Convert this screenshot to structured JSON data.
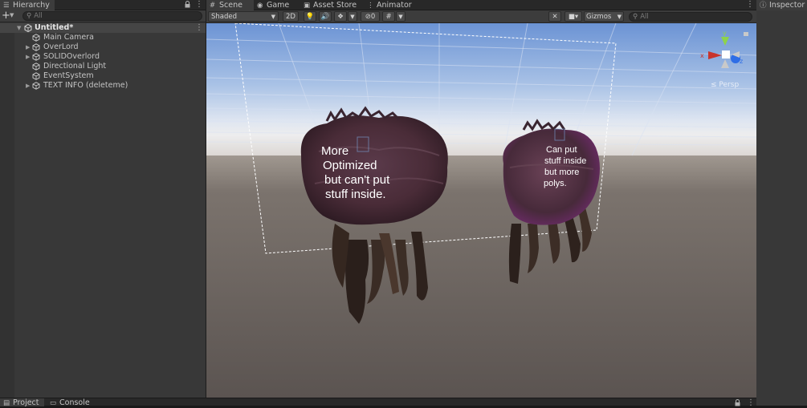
{
  "hierarchy": {
    "tab_label": "Hierarchy",
    "add_label": "+",
    "search_placeholder": "All",
    "root": "Untitled*",
    "items": [
      {
        "label": "Main Camera",
        "expandable": false
      },
      {
        "label": "OverLord",
        "expandable": true
      },
      {
        "label": "SOLIDOverlord",
        "expandable": true
      },
      {
        "label": "Directional Light",
        "expandable": false
      },
      {
        "label": "EventSystem",
        "expandable": false
      },
      {
        "label": "TEXT INFO (deleteme)",
        "expandable": true
      }
    ]
  },
  "scene": {
    "tabs": [
      {
        "label": "Scene",
        "icon": "hash-icon"
      },
      {
        "label": "Game",
        "icon": "gamepad-icon"
      },
      {
        "label": "Asset Store",
        "icon": "bag-icon"
      },
      {
        "label": "Animator",
        "icon": "animator-icon"
      }
    ],
    "toolbar": {
      "shading_mode": "Shaded",
      "mode_2d": "2D",
      "hidden_count": "0",
      "gizmos_label": "Gizmos",
      "search_placeholder": "All"
    },
    "overlay_left": [
      "More",
      "Optimized",
      "but can't put",
      "stuff inside."
    ],
    "overlay_right": [
      "Can put",
      "stuff inside",
      "but more",
      "polys."
    ],
    "gizmo": {
      "y": "y",
      "x": "x",
      "z": "z",
      "persp": "Persp"
    }
  },
  "inspector": {
    "tab_label": "Inspector"
  },
  "bottom": {
    "tabs": [
      {
        "label": "Project"
      },
      {
        "label": "Console"
      }
    ]
  },
  "colors": {
    "panel_bg": "#383838",
    "tab_bg": "#282828",
    "sky_top": "#6f97d6",
    "horizon": "#e9e8ea",
    "ground": "#5a5451",
    "selection": "#454545"
  }
}
